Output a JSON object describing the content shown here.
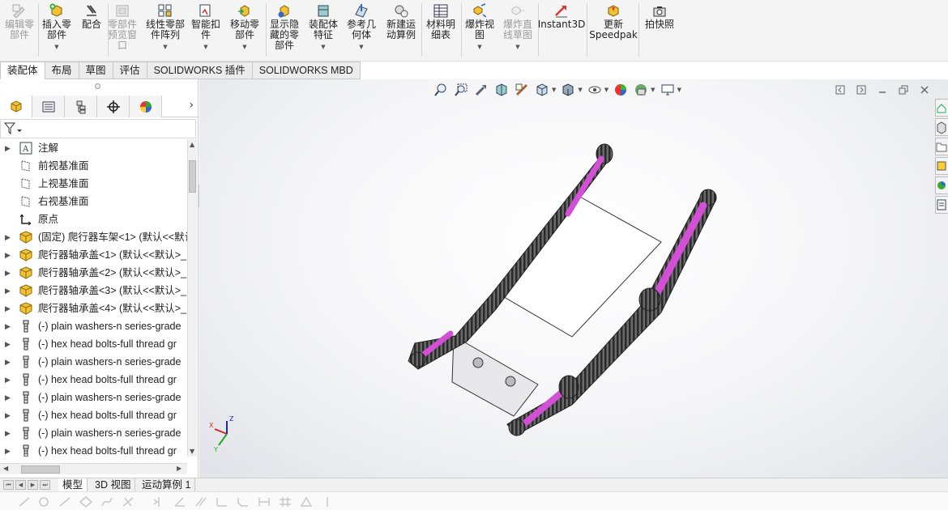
{
  "ribbon": {
    "buttons": [
      {
        "id": "edit-component",
        "label": "编辑零\n部件",
        "disabled": true,
        "icon": "edit-component-icon"
      },
      {
        "id": "insert-component",
        "label": "插入零\n部件",
        "disabled": false,
        "icon": "insert-component-icon"
      },
      {
        "id": "mate",
        "label": "配合",
        "disabled": false,
        "icon": "mate-icon"
      },
      {
        "id": "component-preview",
        "label": "零部件\n预览窗\n口",
        "disabled": true,
        "icon": "preview-window-icon"
      },
      {
        "id": "linear-pattern",
        "label": "线性零部\n件阵列",
        "disabled": false,
        "icon": "linear-pattern-icon"
      },
      {
        "id": "smart-fasteners",
        "label": "智能扣\n件",
        "disabled": false,
        "icon": "smart-fastener-icon"
      },
      {
        "id": "move-component",
        "label": "移动零\n部件",
        "disabled": false,
        "icon": "move-component-icon"
      },
      {
        "id": "show-hidden",
        "label": "显示隐\n藏的零\n部件",
        "disabled": false,
        "icon": "show-hidden-icon"
      },
      {
        "id": "assembly-features",
        "label": "装配体\n特征",
        "disabled": false,
        "icon": "assembly-feature-icon"
      },
      {
        "id": "reference-geometry",
        "label": "参考几\n何体",
        "disabled": false,
        "icon": "reference-geometry-icon"
      },
      {
        "id": "new-motion-study",
        "label": "新建运\n动算例",
        "disabled": false,
        "icon": "motion-study-icon"
      },
      {
        "id": "bom",
        "label": "材料明\n细表",
        "disabled": false,
        "icon": "bom-icon"
      },
      {
        "id": "exploded-view",
        "label": "爆炸视\n图",
        "disabled": false,
        "icon": "exploded-view-icon"
      },
      {
        "id": "explode-line",
        "label": "爆炸直\n线草图",
        "disabled": true,
        "icon": "explode-line-icon"
      },
      {
        "id": "instant3d",
        "label": "Instant3D",
        "disabled": false,
        "icon": "instant3d-icon"
      },
      {
        "id": "update-speedpak",
        "label": "更新\nSpeedpak",
        "disabled": false,
        "icon": "speedpak-icon"
      },
      {
        "id": "take-snapshot",
        "label": "拍快照",
        "disabled": false,
        "icon": "camera-icon"
      }
    ]
  },
  "command_tabs": [
    "装配体",
    "布局",
    "草图",
    "评估",
    "SOLIDWORKS 插件",
    "SOLIDWORKS MBD"
  ],
  "tree": {
    "items": [
      {
        "label": "注解",
        "icon": "annotations-icon",
        "expandable": true
      },
      {
        "label": "前视基准面",
        "icon": "plane-icon",
        "expandable": false
      },
      {
        "label": "上视基准面",
        "icon": "plane-icon",
        "expandable": false
      },
      {
        "label": "右视基准面",
        "icon": "plane-icon",
        "expandable": false
      },
      {
        "label": "原点",
        "icon": "origin-icon",
        "expandable": false
      },
      {
        "label": "(固定) 爬行器车架<1> (默认<<默认",
        "icon": "part-icon",
        "expandable": true
      },
      {
        "label": "爬行器轴承盖<1> (默认<<默认>_",
        "icon": "part-icon",
        "expandable": true
      },
      {
        "label": "爬行器轴承盖<2> (默认<<默认>_",
        "icon": "part-icon",
        "expandable": true
      },
      {
        "label": "爬行器轴承盖<3> (默认<<默认>_",
        "icon": "part-icon",
        "expandable": true
      },
      {
        "label": "爬行器轴承盖<4> (默认<<默认>_",
        "icon": "part-icon",
        "expandable": true
      },
      {
        "label": "(-) plain washers-n series-grade",
        "icon": "toolbox-part-icon",
        "expandable": true
      },
      {
        "label": "(-) hex head bolts-full thread gr",
        "icon": "toolbox-part-icon",
        "expandable": true
      },
      {
        "label": "(-) plain washers-n series-grade",
        "icon": "toolbox-part-icon",
        "expandable": true
      },
      {
        "label": "(-) hex head bolts-full thread gr",
        "icon": "toolbox-part-icon",
        "expandable": true
      },
      {
        "label": "(-) plain washers-n series-grade",
        "icon": "toolbox-part-icon",
        "expandable": true
      },
      {
        "label": "(-) hex head bolts-full thread gr",
        "icon": "toolbox-part-icon",
        "expandable": true
      },
      {
        "label": "(-) plain washers-n series-grade",
        "icon": "toolbox-part-icon",
        "expandable": true
      },
      {
        "label": "(-) hex head bolts-full thread gr",
        "icon": "toolbox-part-icon",
        "expandable": true
      }
    ]
  },
  "bottom_tabs": [
    "模型",
    "3D 视图",
    "运动算例 1"
  ],
  "colors": {
    "accent_magenta": "#d24fd6",
    "track_dark": "#3c3c3c",
    "body_white": "#ffffff",
    "part_yellow": "#f2c233"
  }
}
